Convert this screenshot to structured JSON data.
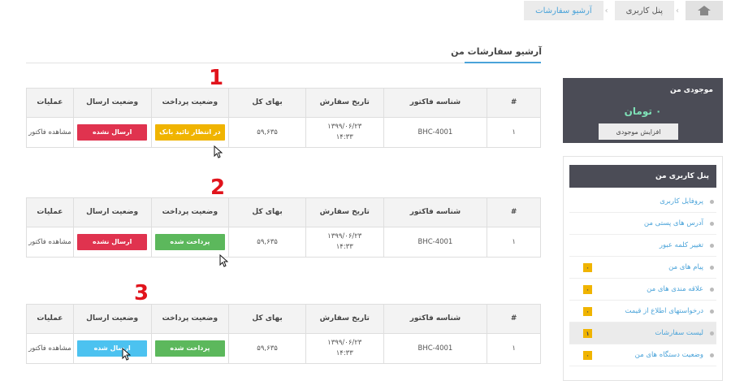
{
  "breadcrumb": {
    "items": [
      "آرشیو سفارشات",
      "پنل کاربری"
    ]
  },
  "page_title": "آرشیو سفارشات من",
  "table_headers": {
    "num": "#",
    "invoice": "شناسه فاکتور",
    "date": "تاریخ سفارش",
    "total": "بهای کل",
    "payment": "وضعیت پرداخت",
    "shipping": "وضعیت ارسال",
    "ops": "عملیات"
  },
  "orders": [
    {
      "step": "1",
      "num": "۱",
      "invoice": "BHC-4001",
      "date": "۱۳۹۹/۰۶/۲۳",
      "time": "۱۴:۳۳",
      "total": "۵۹,۶۳۵",
      "payment": "در انتظار تائید بانک",
      "payment_color": "#f0b400",
      "shipping": "ارسال نشده",
      "shipping_color": "#e0334f",
      "ops": "مشاهده فاکتور"
    },
    {
      "step": "2",
      "num": "۱",
      "invoice": "BHC-4001",
      "date": "۱۳۹۹/۰۶/۲۳",
      "time": "۱۴:۳۳",
      "total": "۵۹,۶۳۵",
      "payment": "پرداخت شده",
      "payment_color": "#5cb85c",
      "shipping": "ارسال نشده",
      "shipping_color": "#e0334f",
      "ops": "مشاهده فاکتور"
    },
    {
      "step": "3",
      "num": "۱",
      "invoice": "BHC-4001",
      "date": "۱۳۹۹/۰۶/۲۳",
      "time": "۱۴:۳۳",
      "total": "۵۹,۶۳۵",
      "payment": "پرداخت شده",
      "payment_color": "#5cb85c",
      "shipping": "ارسال شده",
      "shipping_color": "#4cc2f0",
      "ops": "مشاهده فاکتور"
    }
  ],
  "wallet": {
    "title": "موجودی من",
    "amount": "۰ تومان",
    "button": "افزایش موجودی"
  },
  "panel": {
    "title": "پنل کاربری من",
    "items": [
      {
        "label": "پروفایل کاربری",
        "count": ""
      },
      {
        "label": "آدرس های پستی من",
        "count": ""
      },
      {
        "label": "تغییر کلمه عبور",
        "count": ""
      },
      {
        "label": "پیام های من",
        "count": "۰"
      },
      {
        "label": "علاقه مندی های من",
        "count": "۰"
      },
      {
        "label": "درخواستهای اطلاع از قیمت",
        "count": "۰"
      },
      {
        "label": "لیست سفارشات",
        "count": "۱"
      },
      {
        "label": "وضعیت دستگاه های من",
        "count": "۰"
      }
    ]
  }
}
